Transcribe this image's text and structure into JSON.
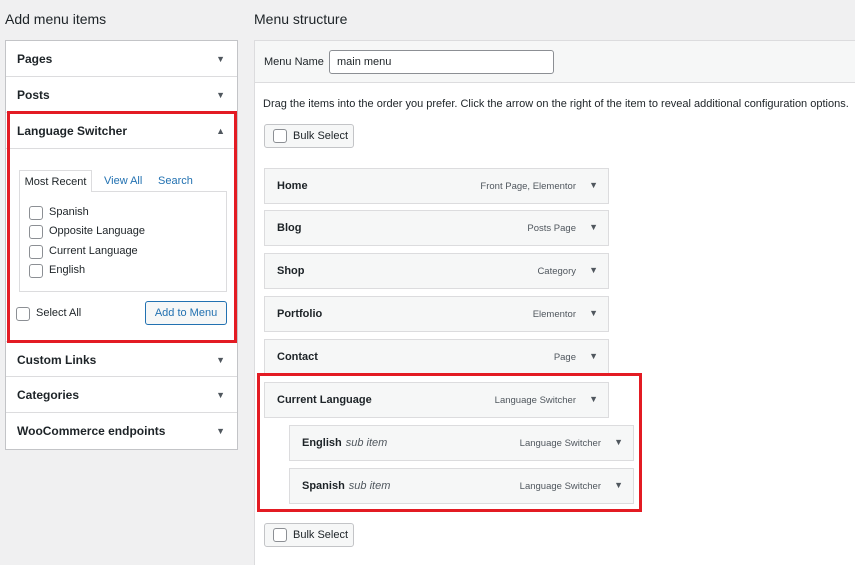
{
  "left": {
    "title": "Add menu items",
    "arrow_down": "▼",
    "arrow_up": "▲",
    "sections": [
      "Pages",
      "Posts",
      "Language Switcher",
      "Custom Links",
      "Categories",
      "WooCommerce endpoints"
    ],
    "tabs": [
      "Most Recent",
      "View All",
      "Search"
    ],
    "options": [
      "Spanish",
      "Opposite Language",
      "Current Language",
      "English"
    ],
    "select_all": "Select All",
    "add_button": "Add to Menu"
  },
  "right": {
    "title": "Menu structure",
    "menu_name_label": "Menu Name",
    "menu_name_value": "main menu",
    "instructions": "Drag the items into the order you prefer. Click the arrow on the right of the item to reveal additional configuration options.",
    "bulk_select": "Bulk Select",
    "items": [
      {
        "title": "Home",
        "sub": "",
        "type": "Front Page, Elementor"
      },
      {
        "title": "Blog",
        "sub": "",
        "type": "Posts Page"
      },
      {
        "title": "Shop",
        "sub": "",
        "type": "Category"
      },
      {
        "title": "Portfolio",
        "sub": "",
        "type": "Elementor"
      },
      {
        "title": "Contact",
        "sub": "",
        "type": "Page"
      },
      {
        "title": "Current Language",
        "sub": "",
        "type": "Language Switcher"
      },
      {
        "title": "English",
        "sub": "sub item",
        "type": "Language Switcher"
      },
      {
        "title": "Spanish",
        "sub": "sub item",
        "type": "Language Switcher"
      }
    ]
  },
  "colors": {
    "highlight": "#e31b23",
    "link": "#2271b1"
  }
}
